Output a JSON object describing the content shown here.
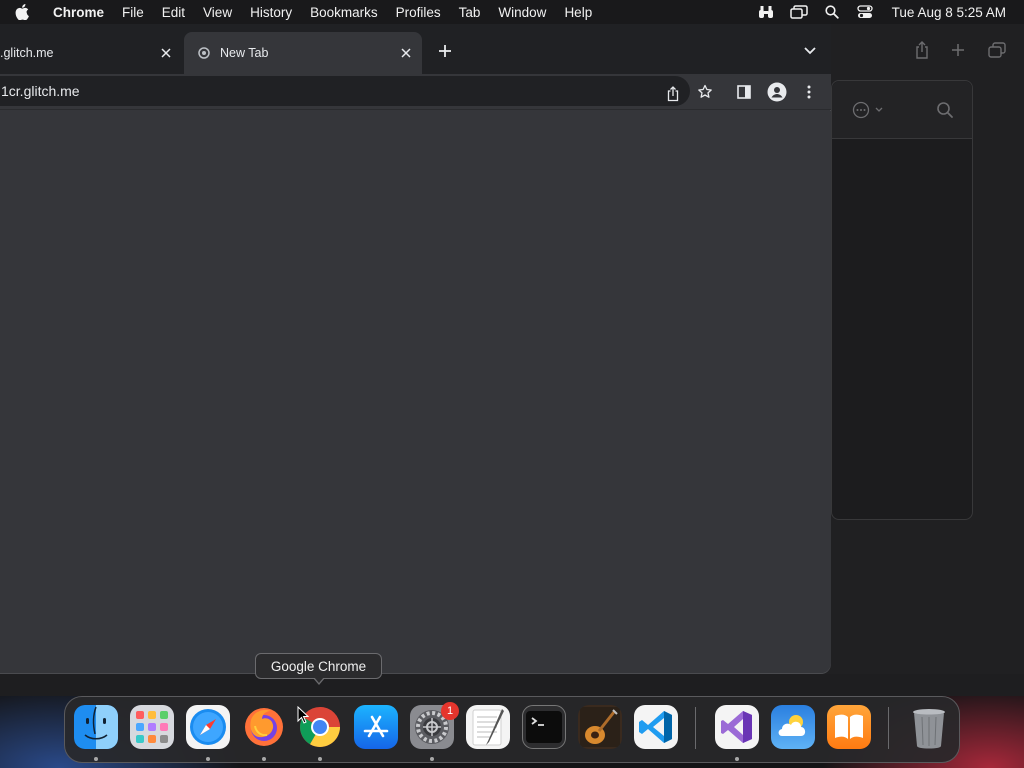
{
  "menubar": {
    "app_name": "Chrome",
    "items": [
      "File",
      "Edit",
      "View",
      "History",
      "Bookmarks",
      "Profiles",
      "Tab",
      "Window",
      "Help"
    ],
    "clock": "Tue Aug 8  5:25 AM"
  },
  "browser": {
    "tabs": [
      {
        "title": ".glitch.me",
        "active": false
      },
      {
        "title": "New Tab",
        "active": true
      }
    ],
    "url": "1cr.glitch.me"
  },
  "tooltip": {
    "text": "Google Chrome"
  },
  "dock": {
    "items": [
      {
        "name": "Finder",
        "running": true
      },
      {
        "name": "Launchpad",
        "running": false
      },
      {
        "name": "Safari",
        "running": true
      },
      {
        "name": "Firefox",
        "running": true
      },
      {
        "name": "Google Chrome",
        "running": true
      },
      {
        "name": "App Store",
        "running": false
      },
      {
        "name": "System Settings",
        "running": true,
        "badge": "1"
      },
      {
        "name": "TextEdit",
        "running": false
      },
      {
        "name": "Terminal",
        "running": false
      },
      {
        "name": "GarageBand",
        "running": false
      },
      {
        "name": "Visual Studio Code",
        "running": false
      },
      {
        "name": "Visual Studio",
        "running": true
      },
      {
        "name": "Weather",
        "running": false
      },
      {
        "name": "Books",
        "running": false
      },
      {
        "name": "Trash",
        "running": false
      }
    ]
  },
  "colors": {
    "chrome_frame": "#202124",
    "chrome_toolbar": "#35363a",
    "badge_red": "#e5352d"
  }
}
